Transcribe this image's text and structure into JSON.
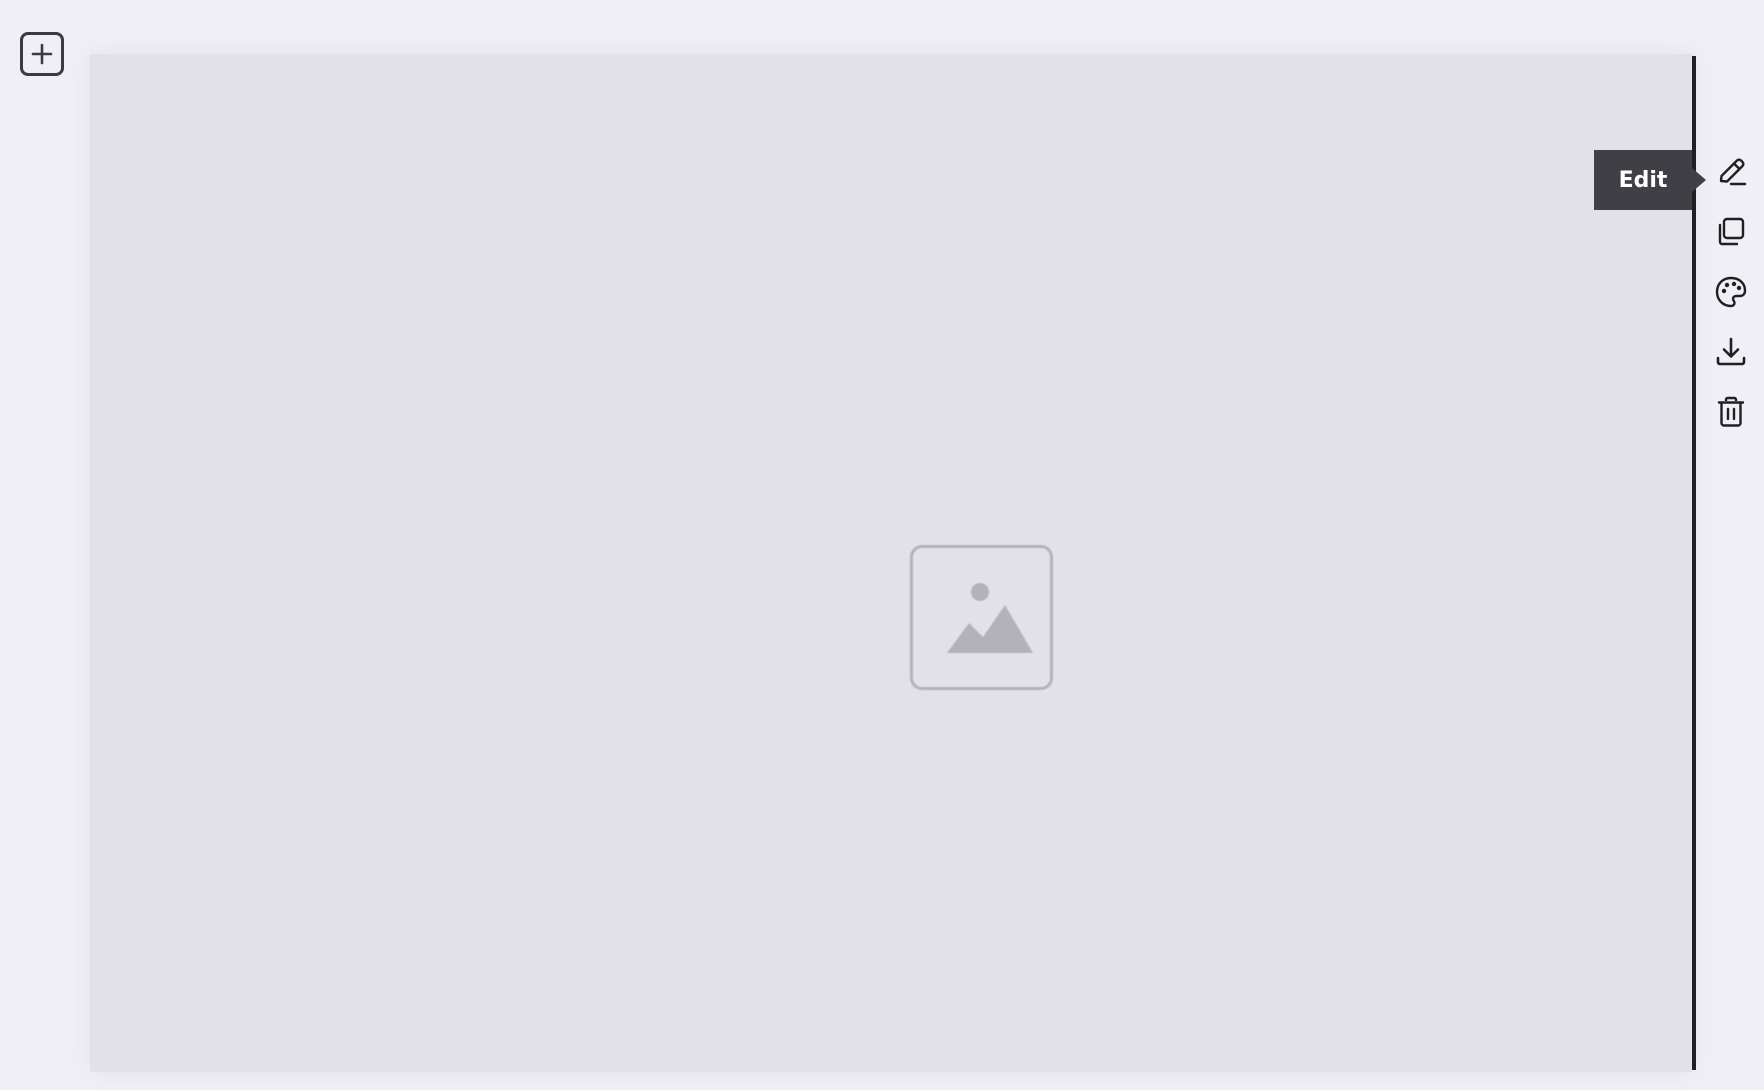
{
  "toolbar": {
    "add_icon": "plus-square-icon",
    "tools": [
      {
        "name": "edit",
        "icon": "pencil-icon"
      },
      {
        "name": "duplicate",
        "icon": "copy-icon"
      },
      {
        "name": "style",
        "icon": "palette-icon"
      },
      {
        "name": "download",
        "icon": "download-icon"
      },
      {
        "name": "delete",
        "icon": "trash-icon"
      }
    ]
  },
  "tooltip": {
    "text": "Edit"
  },
  "canvas": {
    "placeholder_icon": "image-placeholder-icon"
  },
  "colors": {
    "background": "#f0eff5",
    "canvas": "#e2e1ea",
    "tooltip_bg": "#3f3f45",
    "icon": "#1f1f24",
    "placeholder": "#b3b2bb"
  }
}
